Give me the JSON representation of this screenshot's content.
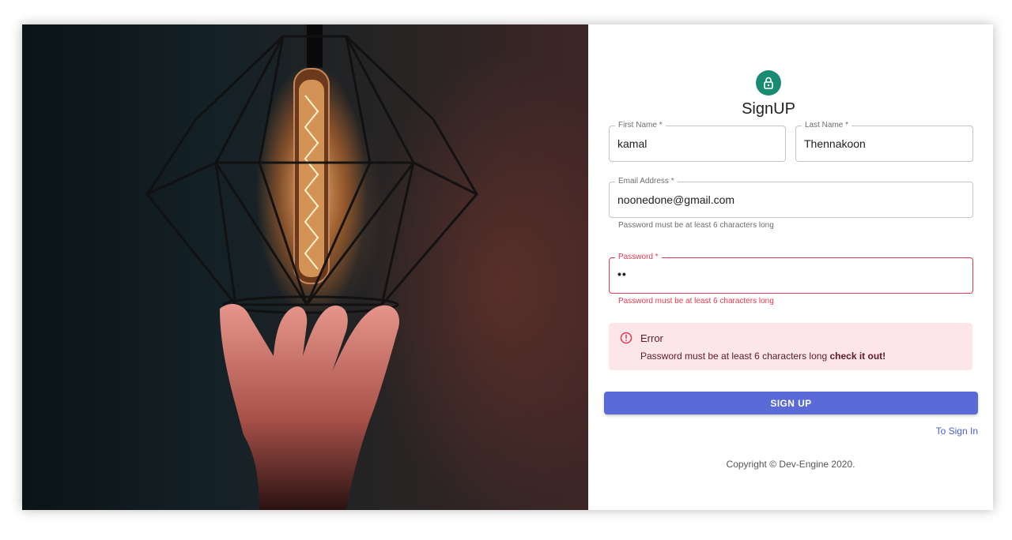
{
  "form": {
    "title": "SignUP",
    "first_name": {
      "label": "First Name *",
      "value": "kamal"
    },
    "last_name": {
      "label": "Last Name *",
      "value": "Thennakoon"
    },
    "email": {
      "label": "Email Address *",
      "value": "noonedone@gmail.com",
      "helper": "Password must be at least 6 characters long"
    },
    "password": {
      "label": "Password *",
      "value": "••",
      "helper": "Password must be at least 6 characters long"
    },
    "submit_label": "SIGN UP",
    "signin_link": "To Sign In"
  },
  "alert": {
    "title": "Error",
    "message": "Password must be at least 6 characters long",
    "emphasis": "check it out!",
    "icon": "error-circle-icon"
  },
  "footer": {
    "copyright": "Copyright © Dev-Engine 2020."
  },
  "icons": {
    "avatar": "lock-icon"
  },
  "colors": {
    "accent": "#5a6ad6",
    "avatar": "#1a8a72",
    "error": "#e53950",
    "alert_bg": "#fde6e9"
  }
}
